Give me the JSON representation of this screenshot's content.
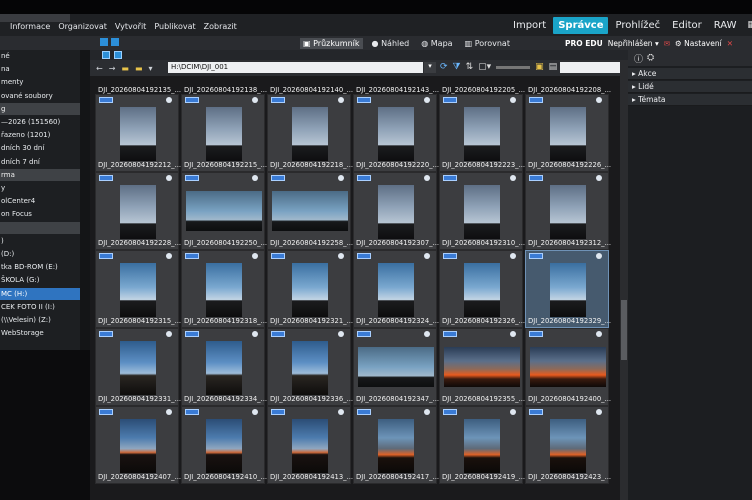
{
  "window": {
    "menubar": [
      "Informace",
      "Organizovat",
      "Vytvořit",
      "Publikovat",
      "Zobrazit"
    ]
  },
  "modes": [
    "Import",
    "Správce",
    "Prohlížeč",
    "Editor",
    "RAW"
  ],
  "active_mode": "Správce",
  "toolbar": {
    "items": [
      "Průzkumník",
      "Náhled",
      "Mapa",
      "Porovnat"
    ],
    "active": "Průzkumník"
  },
  "account": {
    "edition": "PRO EDU",
    "login": "Nepřihlášen",
    "settings": "Nastavení"
  },
  "path": {
    "value": "H:\\DCIM\\DJI_001"
  },
  "sidebar": {
    "items": [
      {
        "label": "né",
        "type": "item"
      },
      {
        "label": "na",
        "type": "item"
      },
      {
        "label": "menty",
        "type": "item"
      },
      {
        "label": "ované soubory",
        "type": "item"
      },
      {
        "label": "g",
        "type": "head"
      },
      {
        "label": "—2026 (151560)",
        "type": "item"
      },
      {
        "label": "řazeno (1201)",
        "type": "item"
      },
      {
        "label": "dních 30 dní",
        "type": "item"
      },
      {
        "label": "dních 7 dní",
        "type": "item"
      },
      {
        "label": "rma",
        "type": "head"
      },
      {
        "label": "y",
        "type": "item"
      },
      {
        "label": "olCenter4",
        "type": "item"
      },
      {
        "label": "on Focus",
        "type": "item"
      },
      {
        "label": "",
        "type": "head"
      },
      {
        "label": ")",
        "type": "item"
      },
      {
        "label": " (D:)",
        "type": "item"
      },
      {
        "label": "tka BD-ROM (E:)",
        "type": "item"
      },
      {
        "label": "ŠKOLA (G:)",
        "type": "item"
      },
      {
        "label": "MC (H:)",
        "type": "sel"
      },
      {
        "label": "CEK FOTO II (I:)",
        "type": "item"
      },
      {
        "label": "(\\\\Velesin) (Z:)",
        "type": "item"
      },
      {
        "label": "WebStorage",
        "type": "item"
      }
    ]
  },
  "right_panel": {
    "sections": [
      "Akce",
      "Lidé",
      "Témata"
    ]
  },
  "files": [
    "DJI_20260804192212_...",
    "DJI_20260804192215_...",
    "DJI_20260804192218_...",
    "DJI_20260804192220_...",
    "DJI_20260804192223_...",
    "DJI_20260804192226_...",
    "DJI_20260804192228_...",
    "DJI_20260804192250_...",
    "DJI_20260804192258_...",
    "DJI_20260804192307_...",
    "DJI_20260804192310_...",
    "DJI_20260804192312_...",
    "DJI_20260804192315_...",
    "DJI_20260804192318_...",
    "DJI_20260804192321_...",
    "DJI_20260804192324_...",
    "DJI_20260804192326_...",
    "DJI_20260804192329_...",
    "DJI_20260804192331_...",
    "DJI_20260804192334_...",
    "DJI_20260804192336_...",
    "DJI_20260804192347_...",
    "DJI_20260804192355_...",
    "DJI_20260804192400_...",
    "DJI_20260804192407_...",
    "DJI_20260804192410_...",
    "DJI_20260804192413_...",
    "DJI_20260804192417_...",
    "DJI_20260804192419_...",
    "DJI_20260804192423_..."
  ],
  "top_partial_files": [
    "DJI_20260804192135_...",
    "DJI_20260804192138_...",
    "DJI_20260804192140_...",
    "DJI_20260804192143_...",
    "DJI_20260804192205_...",
    "DJI_20260804192208_..."
  ],
  "selected_file": "DJI_20260804192329_...",
  "colors": {
    "accent": "#1aa4c8",
    "selection": "#2f74c0"
  }
}
